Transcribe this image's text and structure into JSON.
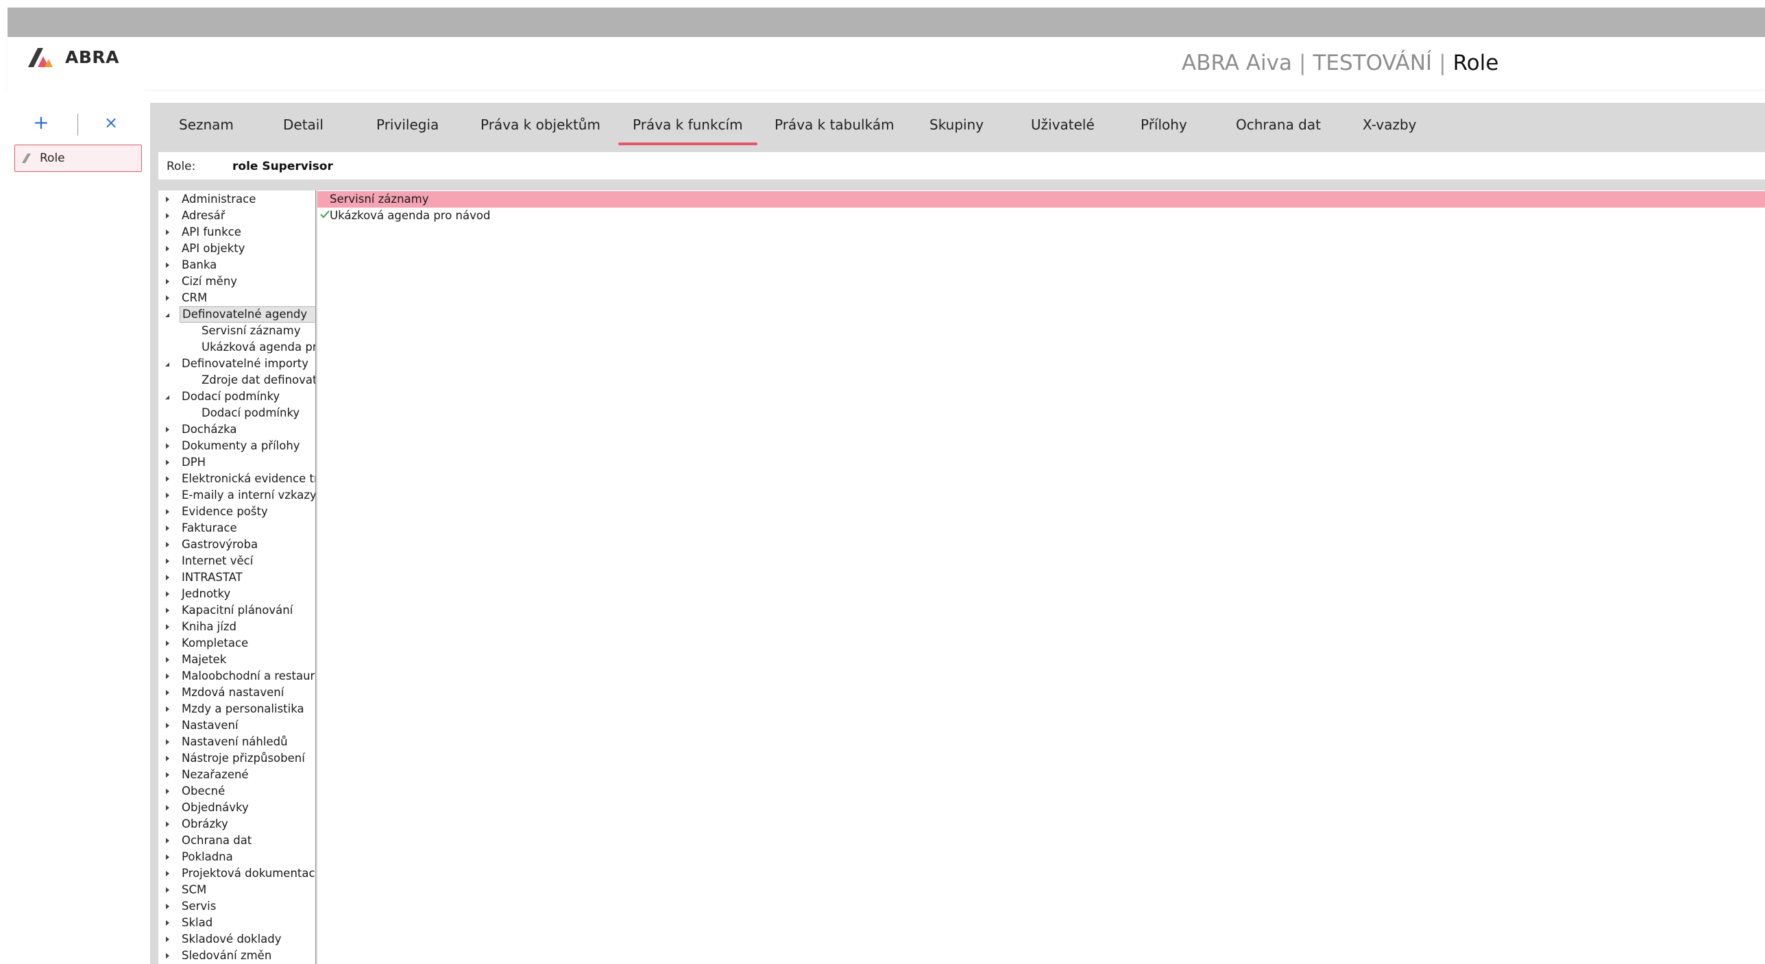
{
  "header": {
    "logo_text": "ABRA",
    "title_parts": [
      "ABRA Aiva",
      "TESTOVÁNÍ",
      "Role"
    ],
    "separator": "|",
    "logo_colors": [
      "#3a3a3a",
      "#e8556a",
      "#f29a3a"
    ]
  },
  "left_panel": {
    "add_icon": "+",
    "close_icon": "×",
    "item_label": "Role"
  },
  "tabs": [
    {
      "label": "Seznam",
      "active": false
    },
    {
      "label": "Detail",
      "active": false
    },
    {
      "label": "Privilegia",
      "active": false
    },
    {
      "label": "Práva k objektům",
      "active": false
    },
    {
      "label": "Práva k funkcím",
      "active": true
    },
    {
      "label": "Práva k tabulkám",
      "active": false
    },
    {
      "label": "Skupiny",
      "active": false
    },
    {
      "label": "Uživatelé",
      "active": false
    },
    {
      "label": "Přílohy",
      "active": false
    },
    {
      "label": "Ochrana dat",
      "active": false
    },
    {
      "label": "X-vazby",
      "active": false
    }
  ],
  "role_bar": {
    "label": "Role:",
    "value": "role Supervisor"
  },
  "tree": [
    {
      "label": "Administrace",
      "state": "collapsed"
    },
    {
      "label": "Adresář",
      "state": "collapsed"
    },
    {
      "label": "API funkce",
      "state": "collapsed"
    },
    {
      "label": "API objekty",
      "state": "collapsed"
    },
    {
      "label": "Banka",
      "state": "collapsed"
    },
    {
      "label": "Cizí měny",
      "state": "collapsed"
    },
    {
      "label": "CRM",
      "state": "collapsed"
    },
    {
      "label": "Definovatelné agendy",
      "state": "expanded",
      "selected": true
    },
    {
      "label": "Servisní záznamy",
      "state": "child"
    },
    {
      "label": "Ukázková agenda pro",
      "state": "child"
    },
    {
      "label": "Definovatelné importy",
      "state": "expanded"
    },
    {
      "label": "Zdroje dat definovatel",
      "state": "child"
    },
    {
      "label": "Dodací podmínky",
      "state": "expanded"
    },
    {
      "label": "Dodací podmínky",
      "state": "child"
    },
    {
      "label": "Docházka",
      "state": "collapsed"
    },
    {
      "label": "Dokumenty a přílohy",
      "state": "collapsed"
    },
    {
      "label": "DPH",
      "state": "collapsed"
    },
    {
      "label": "Elektronická evidence trže",
      "state": "collapsed"
    },
    {
      "label": "E-maily a interní vzkazy",
      "state": "collapsed"
    },
    {
      "label": "Evidence pošty",
      "state": "collapsed"
    },
    {
      "label": "Fakturace",
      "state": "collapsed"
    },
    {
      "label": "Gastrovýroba",
      "state": "collapsed"
    },
    {
      "label": "Internet věcí",
      "state": "collapsed"
    },
    {
      "label": "INTRASTAT",
      "state": "collapsed"
    },
    {
      "label": "Jednotky",
      "state": "collapsed"
    },
    {
      "label": "Kapacitní plánování",
      "state": "collapsed"
    },
    {
      "label": "Kniha jízd",
      "state": "collapsed"
    },
    {
      "label": "Kompletace",
      "state": "collapsed"
    },
    {
      "label": "Majetek",
      "state": "collapsed"
    },
    {
      "label": "Maloobchodní a restaurač",
      "state": "collapsed"
    },
    {
      "label": "Mzdová nastavení",
      "state": "collapsed"
    },
    {
      "label": "Mzdy a personalistika",
      "state": "collapsed"
    },
    {
      "label": "Nastavení",
      "state": "collapsed"
    },
    {
      "label": "Nastavení náhledů",
      "state": "collapsed"
    },
    {
      "label": "Nástroje přizpůsobení",
      "state": "collapsed"
    },
    {
      "label": "Nezařazené",
      "state": "collapsed"
    },
    {
      "label": "Obecné",
      "state": "collapsed"
    },
    {
      "label": "Objednávky",
      "state": "collapsed"
    },
    {
      "label": "Obrázky",
      "state": "collapsed"
    },
    {
      "label": "Ochrana dat",
      "state": "collapsed"
    },
    {
      "label": "Pokladna",
      "state": "collapsed"
    },
    {
      "label": "Projektová dokumentace",
      "state": "collapsed"
    },
    {
      "label": "SCM",
      "state": "collapsed"
    },
    {
      "label": "Servis",
      "state": "collapsed"
    },
    {
      "label": "Sklad",
      "state": "collapsed"
    },
    {
      "label": "Skladové doklady",
      "state": "collapsed"
    },
    {
      "label": "Sledování změn",
      "state": "collapsed"
    }
  ],
  "right_list": [
    {
      "label": "Servisní záznamy",
      "highlighted": true,
      "checked": false
    },
    {
      "label": "Ukázková agenda pro návod",
      "highlighted": false,
      "checked": true
    }
  ],
  "colors": {
    "accent": "#e8556a",
    "highlight_row": "#f6a3b3",
    "tab_bar": "#d9d9d9",
    "top_bar": "#b2b2b2",
    "icon_blue": "#2d6fd0",
    "check_green": "#3aa64a"
  }
}
